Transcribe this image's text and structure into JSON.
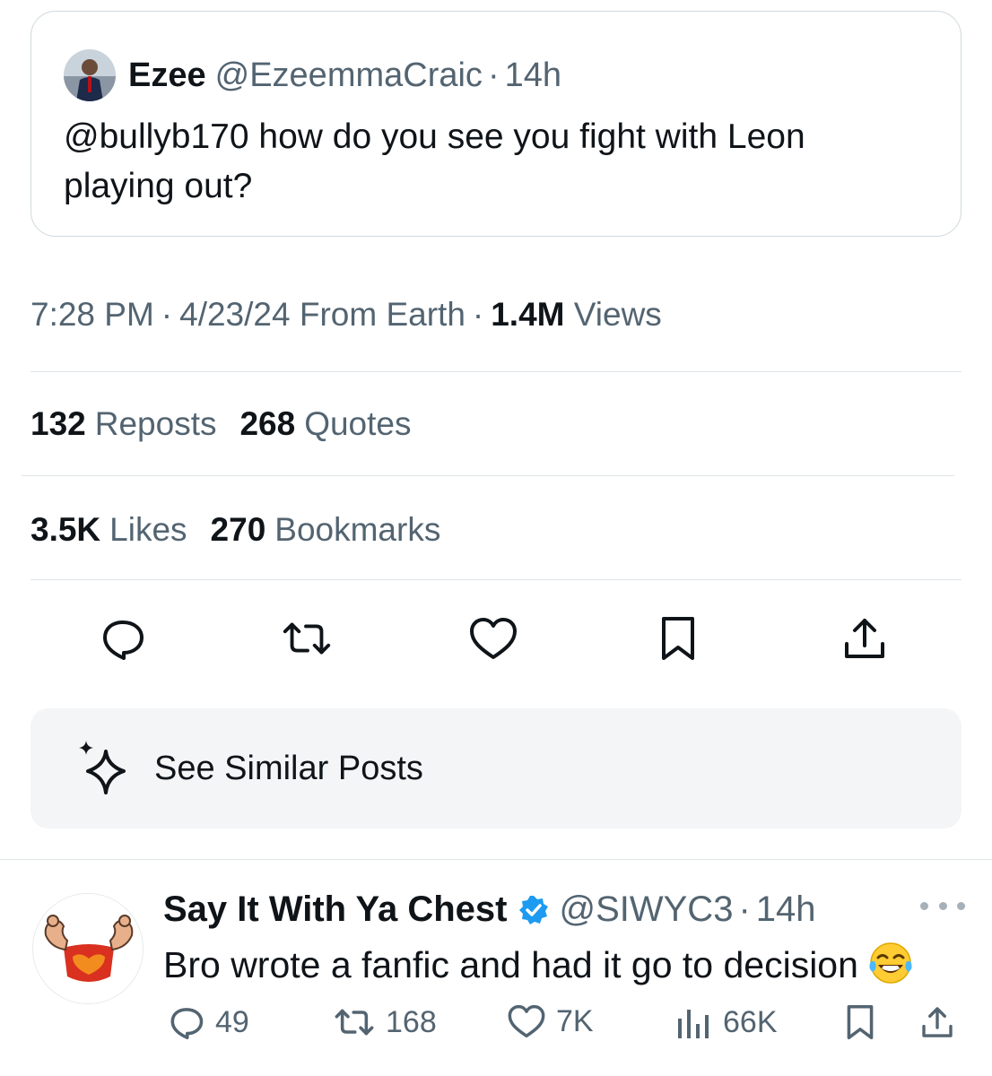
{
  "quoted_tweet": {
    "author_name": "Ezee",
    "handle": "@EzeemmaCraic",
    "separator": "·",
    "time": "14h",
    "text": "@bullyb170 how do you see you fight with Leon playing out?"
  },
  "tweet_meta": {
    "time": "7:28 PM",
    "separator": "·",
    "date": "4/23/24",
    "source": "From Earth",
    "views_count": "1.4M",
    "views_label": "Views"
  },
  "stats": {
    "reposts_count": "132",
    "reposts_label": "Reposts",
    "quotes_count": "268",
    "quotes_label": "Quotes",
    "likes_count": "3.5K",
    "likes_label": "Likes",
    "bookmarks_count": "270",
    "bookmarks_label": "Bookmarks"
  },
  "actions": [
    {
      "icon": "reply-icon"
    },
    {
      "icon": "repost-icon"
    },
    {
      "icon": "like-icon"
    },
    {
      "icon": "bookmark-icon"
    },
    {
      "icon": "share-icon"
    }
  ],
  "similar_posts": {
    "label": "See Similar Posts",
    "icon": "sparkle-icon"
  },
  "reply": {
    "author_name": "Say It With Ya Chest",
    "verified": true,
    "handle": "@SIWYC3",
    "separator": "·",
    "time": "14h",
    "text": "Bro wrote a fanfic and had it go to decision",
    "emoji": "face-with-tears-of-joy",
    "replies": "49",
    "reposts": "168",
    "likes": "7K",
    "views": "66K"
  },
  "colors": {
    "text_primary": "#0f1419",
    "text_secondary": "#536471",
    "divider": "#dfe4e8",
    "verified_blue": "#1d9bf0",
    "card_bg": "#f4f5f6"
  }
}
